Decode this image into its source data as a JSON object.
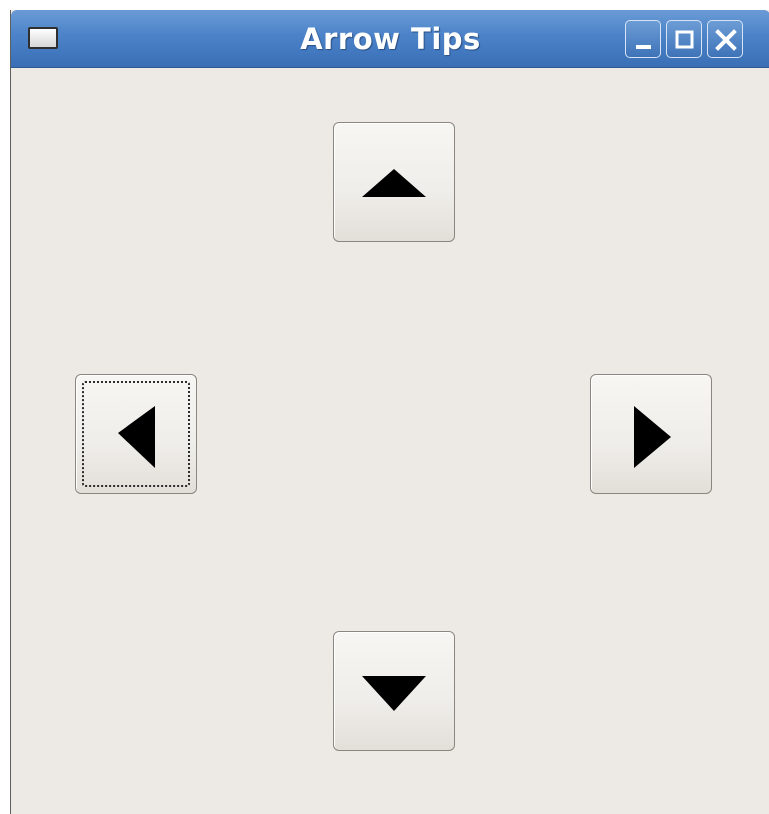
{
  "window": {
    "title": "Arrow Tips",
    "controls": [
      {
        "name": "minimize",
        "icon": "minimize-icon"
      },
      {
        "name": "maximize",
        "icon": "maximize-icon"
      },
      {
        "name": "close",
        "icon": "close-icon"
      }
    ]
  },
  "arrows": [
    {
      "direction": "up",
      "icon": "arrow-up-icon",
      "focused": false
    },
    {
      "direction": "left",
      "icon": "arrow-left-icon",
      "focused": true
    },
    {
      "direction": "right",
      "icon": "arrow-right-icon",
      "focused": false
    },
    {
      "direction": "down",
      "icon": "arrow-down-icon",
      "focused": false
    }
  ],
  "colors": {
    "titlebar": "#4b82c8",
    "window_bg": "#edeae5",
    "arrow_fill": "#000000"
  }
}
